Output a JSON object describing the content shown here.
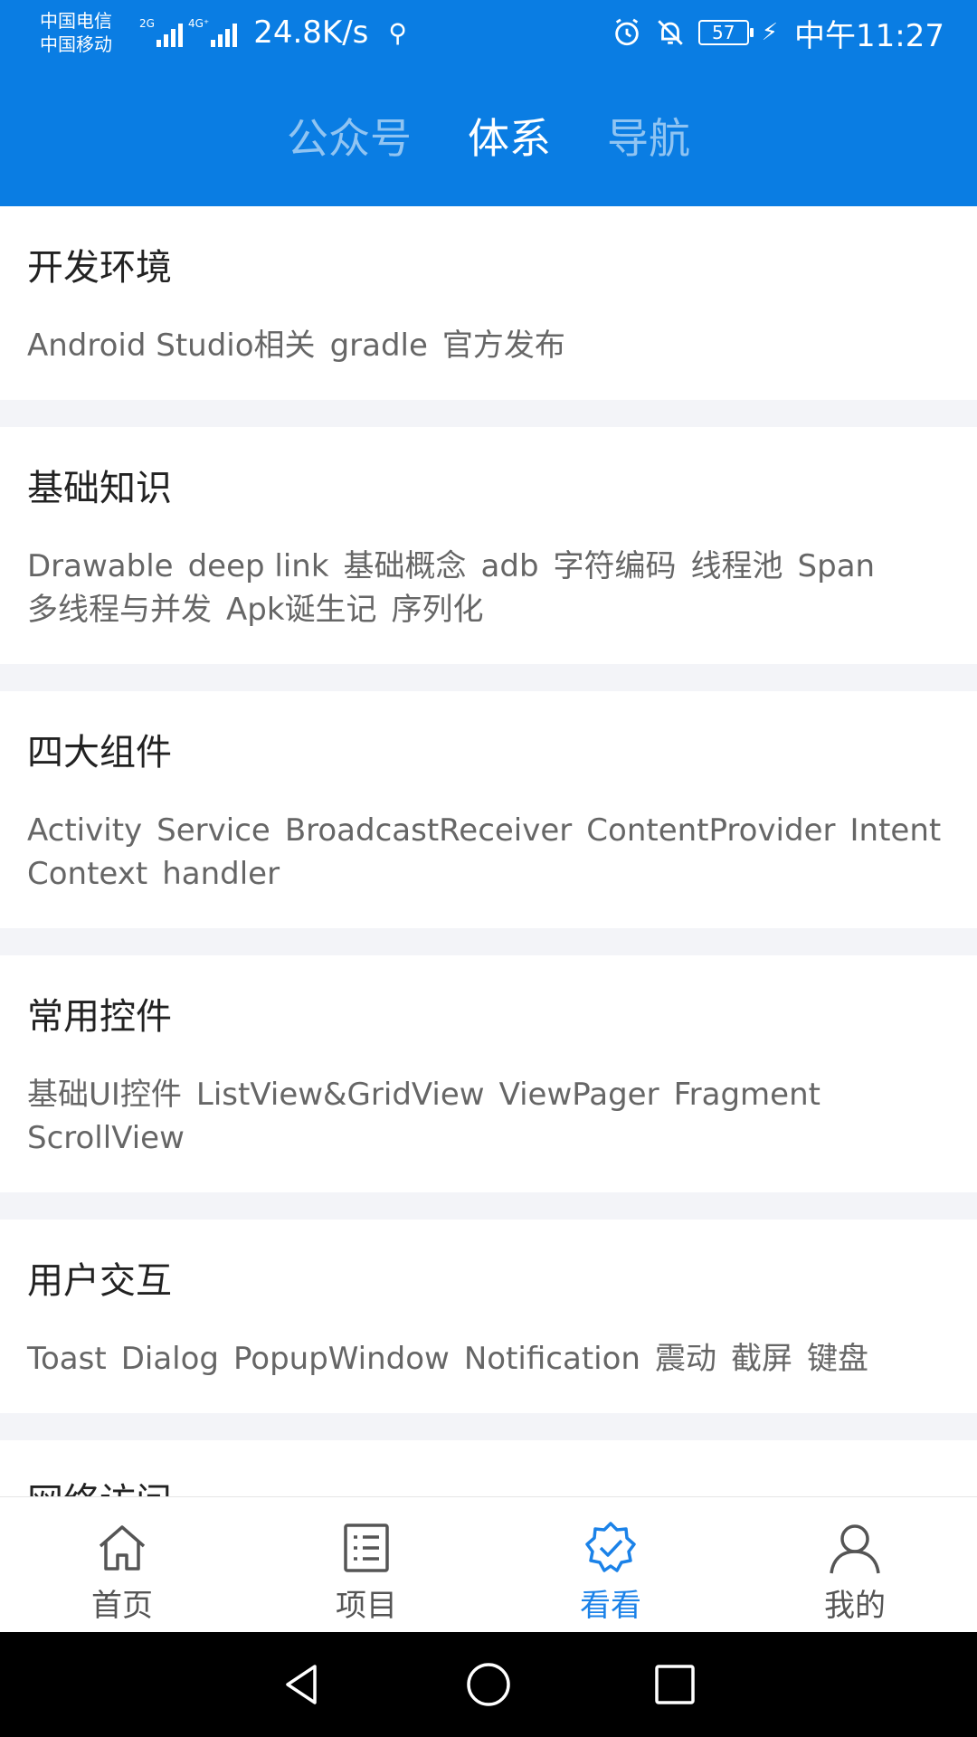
{
  "status_bar": {
    "carrier_1": "中国电信",
    "carrier_2": "中国移动",
    "network_1": "2G",
    "network_2": "4G⁺",
    "speed": "24.8K/s",
    "battery": "57",
    "time": "中午11:27"
  },
  "top_tabs": [
    {
      "label": "公众号",
      "active": false
    },
    {
      "label": "体系",
      "active": true
    },
    {
      "label": "导航",
      "active": false
    }
  ],
  "categories": [
    {
      "title": "开发环境",
      "tags": [
        "Android Studio相关",
        "gradle",
        "官方发布"
      ]
    },
    {
      "title": "基础知识",
      "tags": [
        "Drawable",
        "deep link",
        "基础概念",
        "adb",
        "字符编码",
        "线程池",
        "Span",
        "多线程与并发",
        "Apk诞生记",
        "序列化"
      ]
    },
    {
      "title": "四大组件",
      "tags": [
        "Activity",
        "Service",
        "BroadcastReceiver",
        "ContentProvider",
        "Intent",
        "Context",
        "handler"
      ]
    },
    {
      "title": "常用控件",
      "tags": [
        "基础UI控件",
        "ListView&GridView",
        "ViewPager",
        "Fragment",
        "ScrollView"
      ]
    },
    {
      "title": "用户交互",
      "tags": [
        "Toast",
        "Dialog",
        "PopupWindow",
        "Notification",
        "震动",
        "截屏",
        "键盘"
      ]
    },
    {
      "title": "网络访问",
      "tags": []
    }
  ],
  "bottom_nav": [
    {
      "label": "首页",
      "icon": "home-icon",
      "active": false
    },
    {
      "label": "项目",
      "icon": "list-icon",
      "active": false
    },
    {
      "label": "看看",
      "icon": "badge-check-icon",
      "active": true
    },
    {
      "label": "我的",
      "icon": "user-icon",
      "active": false
    }
  ],
  "colors": {
    "primary": "#0a7de3",
    "active_nav": "#1b82e8",
    "divider": "#f3f4f8"
  }
}
